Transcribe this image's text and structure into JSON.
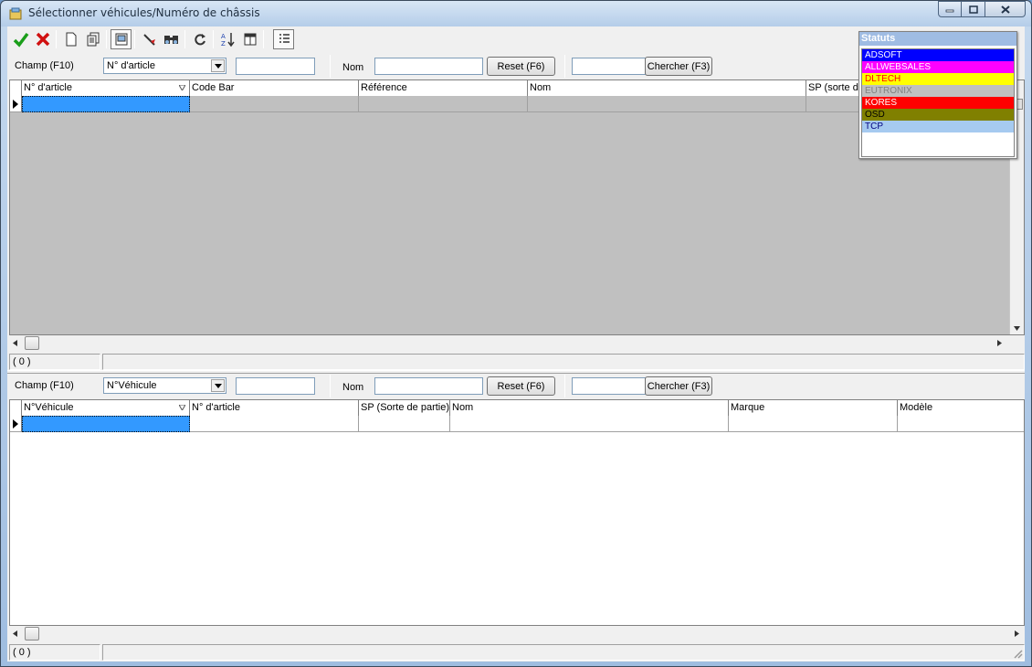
{
  "window": {
    "title": "Sélectionner véhicules/Numéro de châssis",
    "min_icon": "minimize-icon",
    "max_icon": "maximize-icon",
    "close_icon": "close-icon"
  },
  "toolbar": {
    "icons": [
      "confirm-check-icon",
      "cancel-x-icon",
      "new-document-icon",
      "copy-document-icon",
      "print-preview-icon",
      "filter-icon",
      "find-binoculars-icon",
      "refresh-icon",
      "sort-az-icon",
      "columns-icon",
      "list-view-icon"
    ]
  },
  "top": {
    "champ_label": "Champ (F10)",
    "champ_value": "N° d'article",
    "nom_label": "Nom",
    "reset_button": "Reset (F6)",
    "search_button": "Chercher (F3)",
    "columns": [
      "N° d'article",
      "Code Bar",
      "Référence",
      "Nom",
      "SP (sorte de"
    ],
    "status_count": "( 0 )"
  },
  "bottom": {
    "champ_label": "Champ (F10)",
    "champ_value": "N°Véhicule",
    "nom_label": "Nom",
    "reset_button": "Reset (F6)",
    "search_button": "Chercher (F3)",
    "columns": [
      "N°Véhicule",
      "N° d'article",
      "SP (Sorte de partie)",
      "Nom",
      "Marque",
      "Modèle"
    ],
    "status_count": "( 0 )"
  },
  "statuts": {
    "title": "Statuts",
    "items": [
      {
        "label": "ADSOFT",
        "bg": "#0000ff",
        "fg": "#ffffff"
      },
      {
        "label": "ALLWEBSALES",
        "bg": "#ff00ff",
        "fg": "#ffffff"
      },
      {
        "label": "DLTECH",
        "bg": "#ffff00",
        "fg": "#ff0000"
      },
      {
        "label": "EUTRONIX",
        "bg": "#c0c0c0",
        "fg": "#808080"
      },
      {
        "label": "KORES",
        "bg": "#ff0000",
        "fg": "#ffffff"
      },
      {
        "label": "OSD",
        "bg": "#808000",
        "fg": "#000000"
      },
      {
        "label": "TCP",
        "bg": "#a6caf0",
        "fg": "#000080"
      }
    ]
  }
}
